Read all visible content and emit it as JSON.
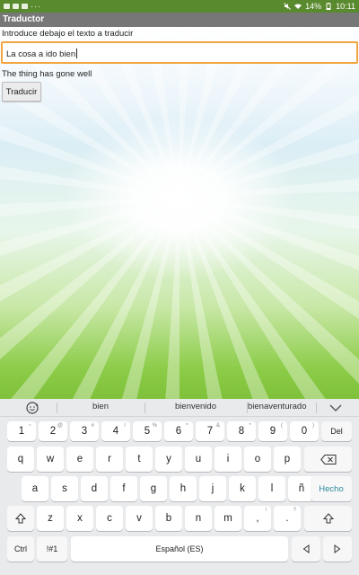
{
  "status": {
    "battery": "14%",
    "time": "10:11",
    "dots": "···"
  },
  "app": {
    "title": "Traductor"
  },
  "form": {
    "instruction": "Introduce debajo el texto a traducir",
    "input_value": "La cosa a ido bien",
    "result": "The thing has gone well",
    "translate_label": "Traducir"
  },
  "keyboard": {
    "suggestions": [
      "bien",
      "bienvenido",
      "bienaventurado"
    ],
    "row1": [
      {
        "k": "1",
        "s": "~"
      },
      {
        "k": "2",
        "s": "@"
      },
      {
        "k": "3",
        "s": "#"
      },
      {
        "k": "4",
        "s": "/"
      },
      {
        "k": "5",
        "s": "%"
      },
      {
        "k": "6",
        "s": "^"
      },
      {
        "k": "7",
        "s": "&"
      },
      {
        "k": "8",
        "s": "*"
      },
      {
        "k": "9",
        "s": "("
      },
      {
        "k": "0",
        "s": ")"
      }
    ],
    "del_label": "Del",
    "row2": [
      "q",
      "w",
      "e",
      "r",
      "t",
      "y",
      "u",
      "i",
      "o",
      "p"
    ],
    "row3": [
      "a",
      "s",
      "d",
      "f",
      "g",
      "h",
      "j",
      "k",
      "l",
      "ñ"
    ],
    "hecho_label": "Hecho",
    "row4": [
      {
        "k": "z",
        "s": ""
      },
      {
        "k": "x",
        "s": ""
      },
      {
        "k": "c",
        "s": ""
      },
      {
        "k": "v",
        "s": ""
      },
      {
        "k": "b",
        "s": ""
      },
      {
        "k": "n",
        "s": ""
      },
      {
        "k": "m",
        "s": ""
      },
      {
        "k": ",",
        "s": "!"
      },
      {
        "k": ".",
        "s": "?"
      }
    ],
    "ctrl_label": "Ctrl",
    "sym_label": "!#1",
    "space_label": "Español (ES)"
  }
}
